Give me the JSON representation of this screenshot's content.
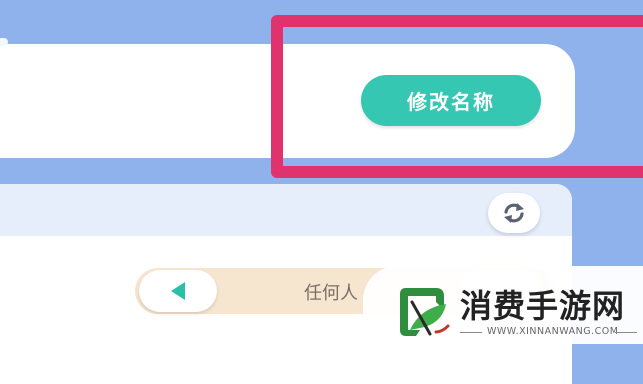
{
  "header_card": {
    "rename_button_label": "修改名称"
  },
  "colors": {
    "background": "#8fb2ec",
    "button_accent": "#35c7b1",
    "highlight_border": "#e0326c",
    "selector_bar": "#f6e5cf"
  },
  "panel": {
    "refresh_icon": "refresh-icon",
    "selector": {
      "prev_icon": "triangle-left-icon",
      "text": "任何人"
    }
  },
  "watermark": {
    "title": "消费手游网",
    "url": "WWW.XINNANWANG.COM",
    "logo_icon": "leaf-logo-icon"
  }
}
